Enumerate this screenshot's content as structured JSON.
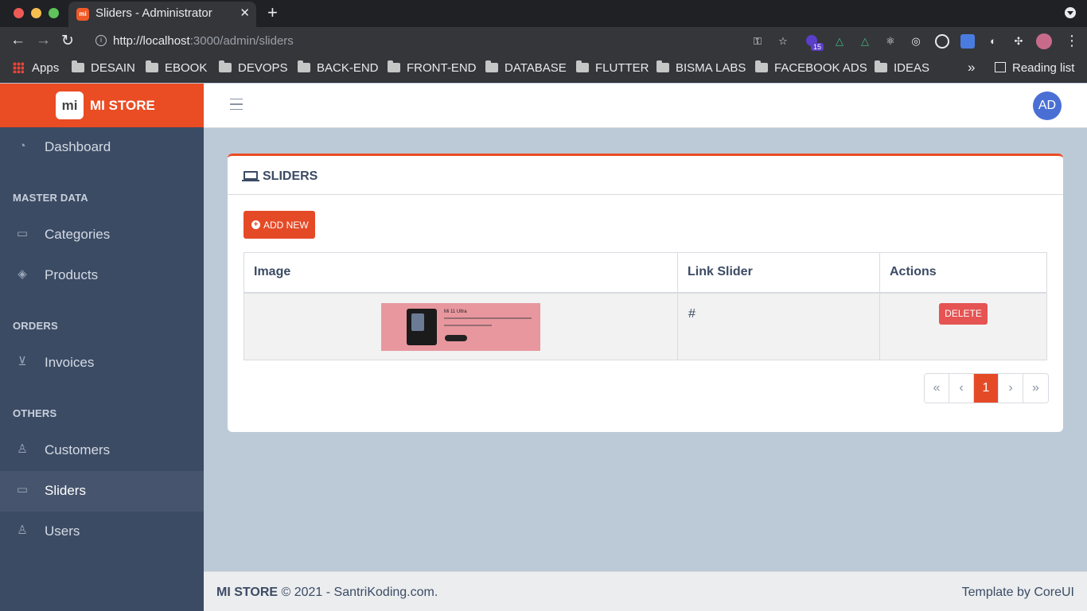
{
  "browser": {
    "tab_title": "Sliders - Administrator",
    "tab_favicon_text": "mi",
    "close_label": "✕",
    "new_tab_label": "+",
    "url_host": "http://localhost",
    "url_path": ":3000/admin/sliders",
    "extension_badge": "15",
    "bookmarks": [
      "Apps",
      "DESAIN",
      "EBOOK",
      "DEVOPS",
      "BACK-END",
      "FRONT-END",
      "DATABASE",
      "FLUTTER",
      "BISMA LABS",
      "FACEBOOK ADS",
      "IDEAS"
    ],
    "bookmarks_more": "»",
    "reading_list": "Reading list"
  },
  "brand": {
    "logo_text": "mi",
    "name": "MI STORE",
    "color": "#ea4c23"
  },
  "sidebar": {
    "dashboard": "Dashboard",
    "sections": {
      "master_data": "MASTER DATA",
      "orders": "ORDERS",
      "others": "OTHERS"
    },
    "categories": "Categories",
    "products": "Products",
    "invoices": "Invoices",
    "customers": "Customers",
    "sliders": "Sliders",
    "users": "Users",
    "active_item": "Sliders"
  },
  "header": {
    "user_initials": "AD"
  },
  "card": {
    "title": "SLIDERS",
    "add_button": "ADD NEW",
    "columns": [
      "Image",
      "Link Slider",
      "Actions"
    ],
    "rows": [
      {
        "thumb_title": "Mi 11 Ultra",
        "link": "#",
        "action": "DELETE"
      }
    ]
  },
  "pagination": {
    "first": "«",
    "prev": "‹",
    "current": "1",
    "next": "›",
    "last": "»"
  },
  "footer": {
    "brand": "MI STORE",
    "copyright": "© 2021 - SantriKoding.com.",
    "template_text": "Template by",
    "template_link": "CoreUI"
  },
  "colors": {
    "accent": "#e54a27",
    "sidebar_bg": "#3c4b64",
    "delete": "#e55353"
  }
}
